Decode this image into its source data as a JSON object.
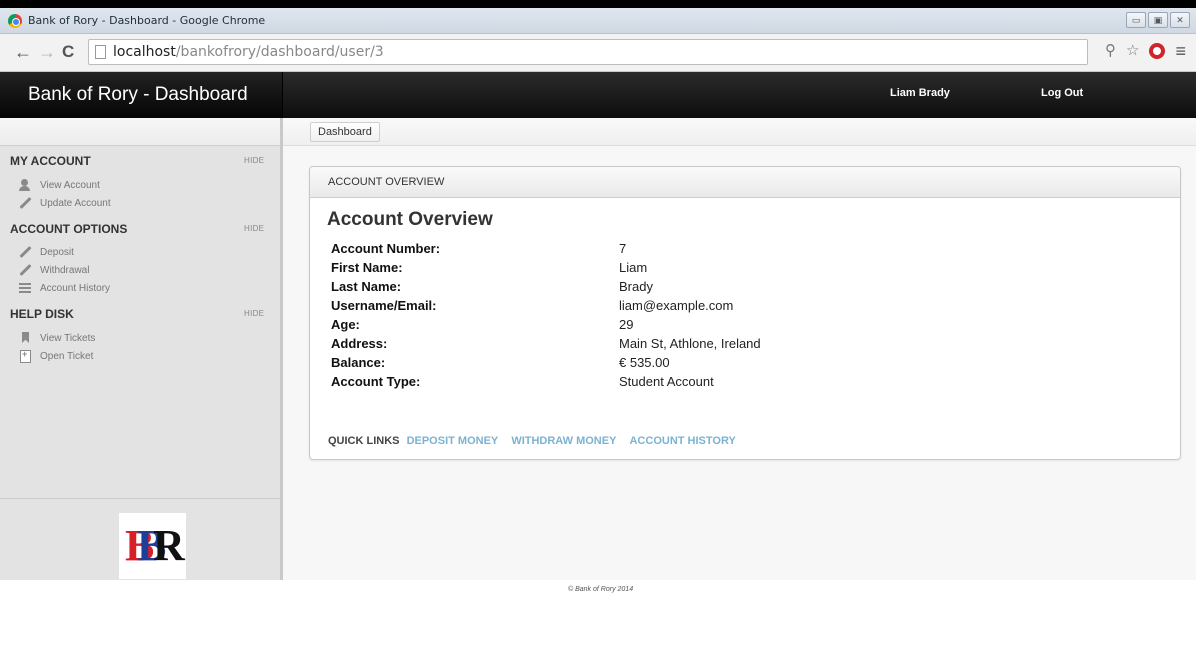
{
  "browser": {
    "window_title": "Bank of Rory - Dashboard - Google Chrome",
    "url_host": "localhost",
    "url_path": "/bankofrory/dashboard/user/3",
    "window_buttons": {
      "minimize": "▭",
      "maximize": "▣",
      "close": "✕"
    }
  },
  "header": {
    "brand": "Bank of Rory - Dashboard",
    "user_name": "Liam Brady",
    "logout": "Log Out"
  },
  "breadcrumb": {
    "item": "Dashboard"
  },
  "sidebar": {
    "sections": [
      {
        "title": "MY ACCOUNT",
        "hide": "HIDE",
        "items": [
          {
            "label": "View Account",
            "icon": "user-icon"
          },
          {
            "label": "Update Account",
            "icon": "pencil-icon"
          }
        ]
      },
      {
        "title": "ACCOUNT OPTIONS",
        "hide": "HIDE",
        "items": [
          {
            "label": "Deposit",
            "icon": "pencil-icon"
          },
          {
            "label": "Withdrawal",
            "icon": "pencil-icon"
          },
          {
            "label": "Account History",
            "icon": "list-icon"
          }
        ]
      },
      {
        "title": "HELP DISK",
        "hide": "HIDE",
        "items": [
          {
            "label": "View Tickets",
            "icon": "bookmark-icon"
          },
          {
            "label": "Open Ticket",
            "icon": "new-ticket-icon"
          }
        ]
      }
    ],
    "logo": {
      "letters": "BR"
    }
  },
  "panel": {
    "header": "ACCOUNT OVERVIEW",
    "title": "Account Overview",
    "details": [
      {
        "label": "Account Number:",
        "value": "7"
      },
      {
        "label": "First Name:",
        "value": "Liam"
      },
      {
        "label": "Last Name:",
        "value": "Brady"
      },
      {
        "label": "Username/Email:",
        "value": "liam@example.com"
      },
      {
        "label": "Age:",
        "value": "29"
      },
      {
        "label": "Address:",
        "value": "Main St, Athlone, Ireland"
      },
      {
        "label": "Balance:",
        "value": "€ 535.00"
      },
      {
        "label": "Account Type:",
        "value": "Student Account"
      }
    ],
    "quick_links": {
      "label": "QUICK LINKS",
      "links": [
        "DEPOSIT MONEY",
        "WITHDRAW MONEY",
        "ACCOUNT HISTORY"
      ]
    }
  },
  "footer": "© Bank of Rory 2014",
  "colors": {
    "header_bg": "#1a1a1a",
    "sidebar_bg": "#e3e3e3",
    "quick_link": "#7ab3d2",
    "logo_red": "#d81f26",
    "logo_blue": "#1d3f9a"
  }
}
